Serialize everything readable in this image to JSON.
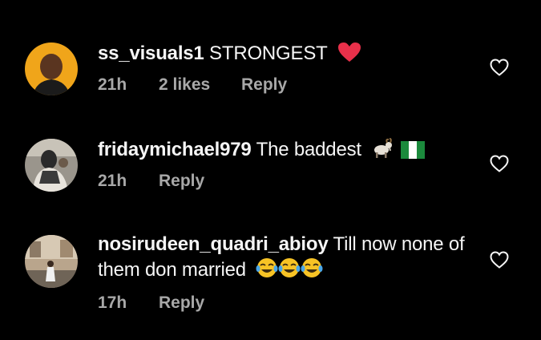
{
  "colors": {
    "background": "#000000",
    "primary_text": "#f5f5f5",
    "secondary_text": "#a8a8a8",
    "heart_emoji": "#e8304a",
    "flag_green": "#1b8a3c"
  },
  "comments": [
    {
      "username": "ss_visuals1",
      "text": "STRONGEST",
      "emojis": [
        "red-heart-emoji"
      ],
      "time": "21h",
      "likes": "2 likes",
      "reply_label": "Reply"
    },
    {
      "username": "fridaymichael979",
      "text": "The baddest",
      "emojis": [
        "goat-emoji",
        "nigeria-flag-emoji"
      ],
      "time": "21h",
      "likes": "",
      "reply_label": "Reply"
    },
    {
      "username": "nosirudeen_quadri_abioy",
      "text": "Till now none of them don married",
      "emojis": [
        "tears-of-joy-emoji",
        "tears-of-joy-emoji",
        "tears-of-joy-emoji"
      ],
      "time": "17h",
      "likes": "",
      "reply_label": "Reply"
    }
  ]
}
